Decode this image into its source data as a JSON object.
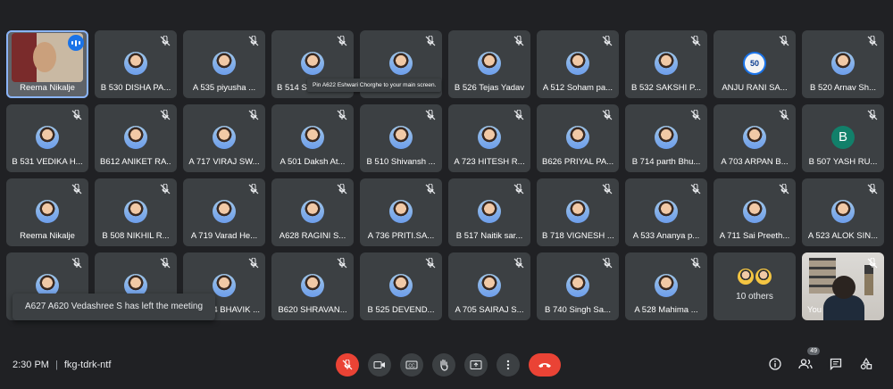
{
  "meeting": {
    "time": "2:30 PM",
    "separator": "|",
    "code": "fkg-tdrk-ntf"
  },
  "tooltip": "Pin A622 Eshwari Chorghe to your main screen.",
  "toast": "A627 A620 Vedashree S has left the meeting",
  "participants_count": "49",
  "self_tile": {
    "name": "Reema Nikalje"
  },
  "others_tile": {
    "label": "10 others"
  },
  "you_tile": {
    "label": "You"
  },
  "tiles": [
    "B 530 DISHA PA...",
    "A 535 piyusha ...",
    "B 514 Sh",
    "",
    "B 526 Tejas Yadav",
    "A 512 Soham pa...",
    "B 532 SAKSHI P...",
    "ANJU RANI SA...",
    "B 520 Arnav Sh...",
    "B 531 VEDIKA H...",
    "B612 ANIKET RA...",
    "A 717 VIRAJ SW...",
    "A 501 Daksh At...",
    "B 510 Shivansh ...",
    "A 723 HITESH R...",
    "B626 PRIYAL PA...",
    "B 714 parth Bhu...",
    "A 703 ARPAN B...",
    "B 507 YASH RU...",
    "Reema Nikalje",
    "B 508 NIKHIL R...",
    "A 719 Varad He...",
    "A628 RAGINI S...",
    "A 736 PRITI.SA...",
    "B 517 Naitik sar...",
    "B 718 VIGNESH ...",
    "A 533 Ananya p...",
    "A 711 Sai Preeth...",
    "A 523 ALOK SIN...",
    "",
    "",
    "04 BHAVIK ...",
    "B620 SHRAVAN...",
    "B 525 DEVEND...",
    "A 705 SAIRAJ S...",
    "B 740 Singh Sa...",
    "A 528 Mahima ..."
  ],
  "letter_avatar": {
    "letter": "B",
    "color": "#12806a"
  },
  "logo_avatar": {
    "text": "50"
  },
  "colors": {
    "background": "#202124",
    "tile": "#3c4043",
    "accent": "#8ab4f8",
    "danger": "#ea4335"
  },
  "controls": [
    "mic-off-icon",
    "camera-icon",
    "captions-icon",
    "raise-hand-icon",
    "present-icon",
    "more-icon",
    "end-call-icon"
  ],
  "side_controls": [
    "info-icon",
    "people-icon",
    "chat-icon",
    "activities-icon"
  ]
}
